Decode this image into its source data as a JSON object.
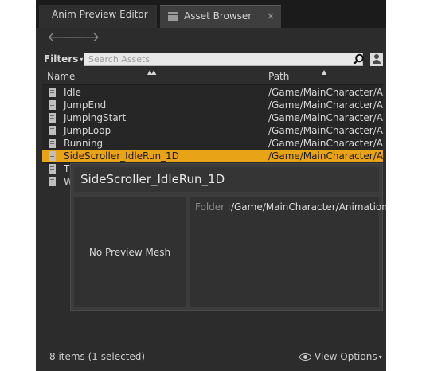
{
  "tabs": [
    {
      "label": "Anim Preview Editor"
    },
    {
      "label": "Asset Browser",
      "close": "×"
    }
  ],
  "nav": {
    "back_glyph": "🡐",
    "forward_glyph": "🡒"
  },
  "filters": {
    "label": "Filters",
    "caret": "▾"
  },
  "search": {
    "placeholder": "Search Assets"
  },
  "columns": {
    "name": "Name",
    "path": "Path",
    "sort_name": "▲▲",
    "sort_path": "▲"
  },
  "rows": [
    {
      "name": "Idle",
      "path": "/Game/MainCharacter/Animation"
    },
    {
      "name": "JumpEnd",
      "path": "/Game/MainCharacter/Animation"
    },
    {
      "name": "JumpingStart",
      "path": "/Game/MainCharacter/Animation"
    },
    {
      "name": "JumpLoop",
      "path": "/Game/MainCharacter/Animation"
    },
    {
      "name": "Running",
      "path": "/Game/MainCharacter/Animation"
    },
    {
      "name": "SideScroller_IdleRun_1D",
      "path": "/Game/MainCharacter/Animation",
      "selected": true
    },
    {
      "name": "Tl"
    },
    {
      "name": "W"
    }
  ],
  "preview": {
    "title": "SideScroller_IdleRun_1D",
    "mesh_text": "No Preview Mesh",
    "folder_label": "Folder :",
    "folder_value": "/Game/MainCharacter/Animation"
  },
  "footer": {
    "count": "8 items (1 selected)",
    "view_options": "View Options",
    "caret": "▾"
  },
  "colors": {
    "selection": "#e8a317",
    "panel": "#2c2c2c",
    "tabbar": "#1b1b1b"
  }
}
